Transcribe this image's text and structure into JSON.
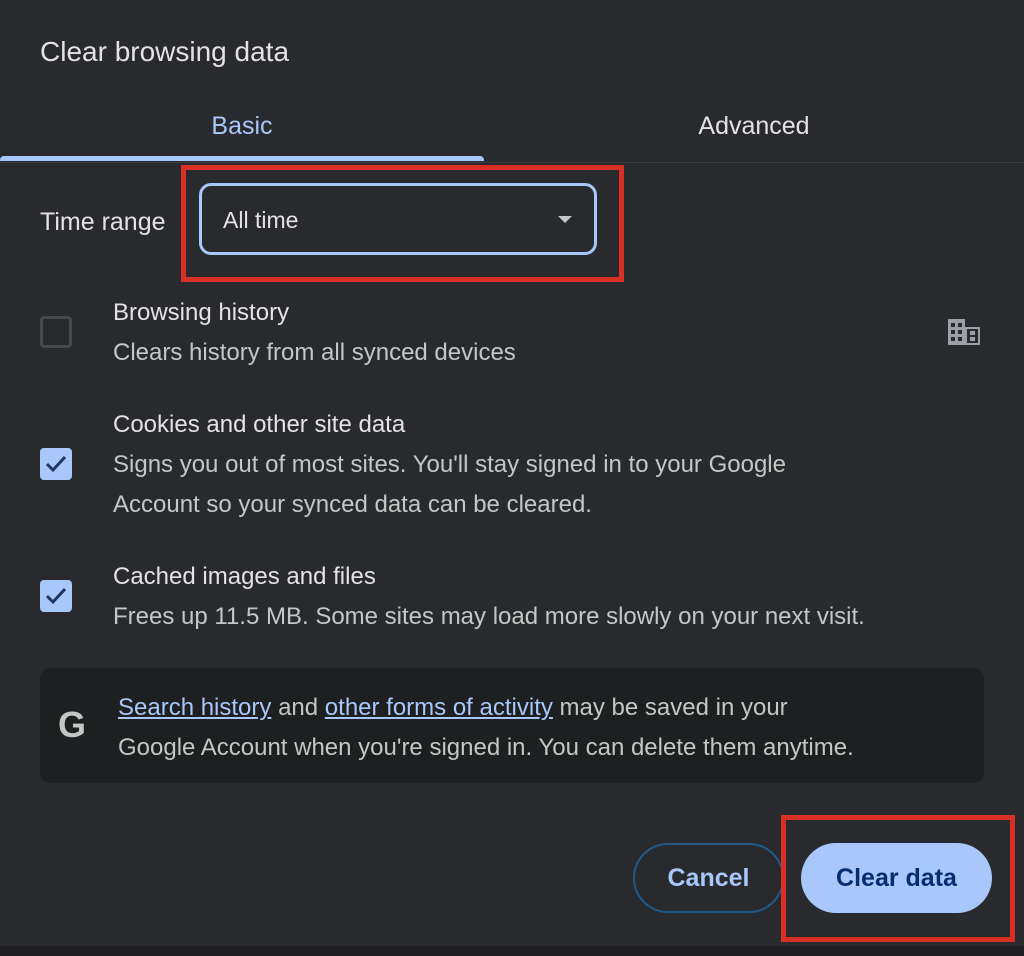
{
  "dialog": {
    "title": "Clear browsing data"
  },
  "tabs": [
    {
      "label": "Basic",
      "selected": true
    },
    {
      "label": "Advanced",
      "selected": false
    }
  ],
  "time_range": {
    "label": "Time range",
    "value": "All time"
  },
  "items": [
    {
      "title": "Browsing history",
      "description": "Clears history from all synced devices",
      "checked": false,
      "trailing_icon": "managed-building-icon"
    },
    {
      "title": "Cookies and other site data",
      "description_line1": "Signs you out of most sites. You'll stay signed in to your Google",
      "description_line2": "Account so your synced data can be cleared.",
      "checked": true
    },
    {
      "title": "Cached images and files",
      "description": "Frees up 11.5 MB. Some sites may load more slowly on your next visit.",
      "checked": true
    }
  ],
  "info": {
    "icon": "google-g-icon",
    "icon_glyph": "G",
    "link1": "Search history",
    "text1": " and ",
    "link2": "other forms of activity",
    "text2": " may be saved in your",
    "line2": "Google Account when you're signed in. You can delete them anytime."
  },
  "buttons": {
    "cancel": "Cancel",
    "clear": "Clear data"
  },
  "colors": {
    "accent": "#a8c7fa",
    "dialog_bg": "#292a2d",
    "highlight": "#d93025"
  }
}
